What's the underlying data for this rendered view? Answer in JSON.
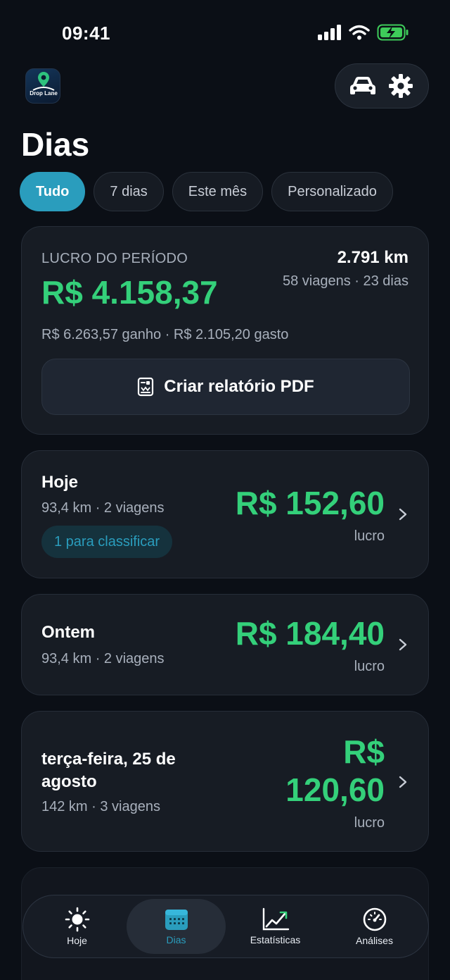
{
  "status_bar": {
    "time": "09:41"
  },
  "app": {
    "logo_text": "Drop Lane"
  },
  "header": {
    "title": "Dias"
  },
  "filters": [
    {
      "label": "Tudo",
      "active": true
    },
    {
      "label": "7 dias",
      "active": false
    },
    {
      "label": "Este mês",
      "active": false
    },
    {
      "label": "Personalizado",
      "active": false
    }
  ],
  "summary": {
    "label": "LUCRO DO PERÍODO",
    "profit": "R$ 4.158,37",
    "distance": "2.791 km",
    "meta": "58 viagens · 23 dias",
    "breakdown": "R$ 6.263,57 ganho · R$ 2.105,20 gasto",
    "pdf_button": "Criar relatório PDF"
  },
  "days": [
    {
      "name": "Hoje",
      "meta": "93,4 km · 2 viagens",
      "amount": "R$ 152,60",
      "amount_label": "lucro",
      "tag": "1 para classificar"
    },
    {
      "name": "Ontem",
      "meta": "93,4 km · 2 viagens",
      "amount": "R$ 184,40",
      "amount_label": "lucro"
    },
    {
      "name": "terça-feira, 25 de agosto",
      "meta": "142 km · 3 viagens",
      "amount": "R$ 120,60",
      "amount_label": "lucro"
    }
  ],
  "tabs": [
    {
      "label": "Hoje",
      "icon": "sun-icon",
      "active": false
    },
    {
      "label": "Dias",
      "icon": "calendar-icon",
      "active": true
    },
    {
      "label": "Estatísticas",
      "icon": "chart-trend-icon",
      "active": false
    },
    {
      "label": "Análises",
      "icon": "gauge-icon",
      "active": false
    }
  ],
  "colors": {
    "accent": "#2a9dbd",
    "profit": "#34d07a",
    "background": "#0b0f16",
    "card": "#171c24"
  }
}
